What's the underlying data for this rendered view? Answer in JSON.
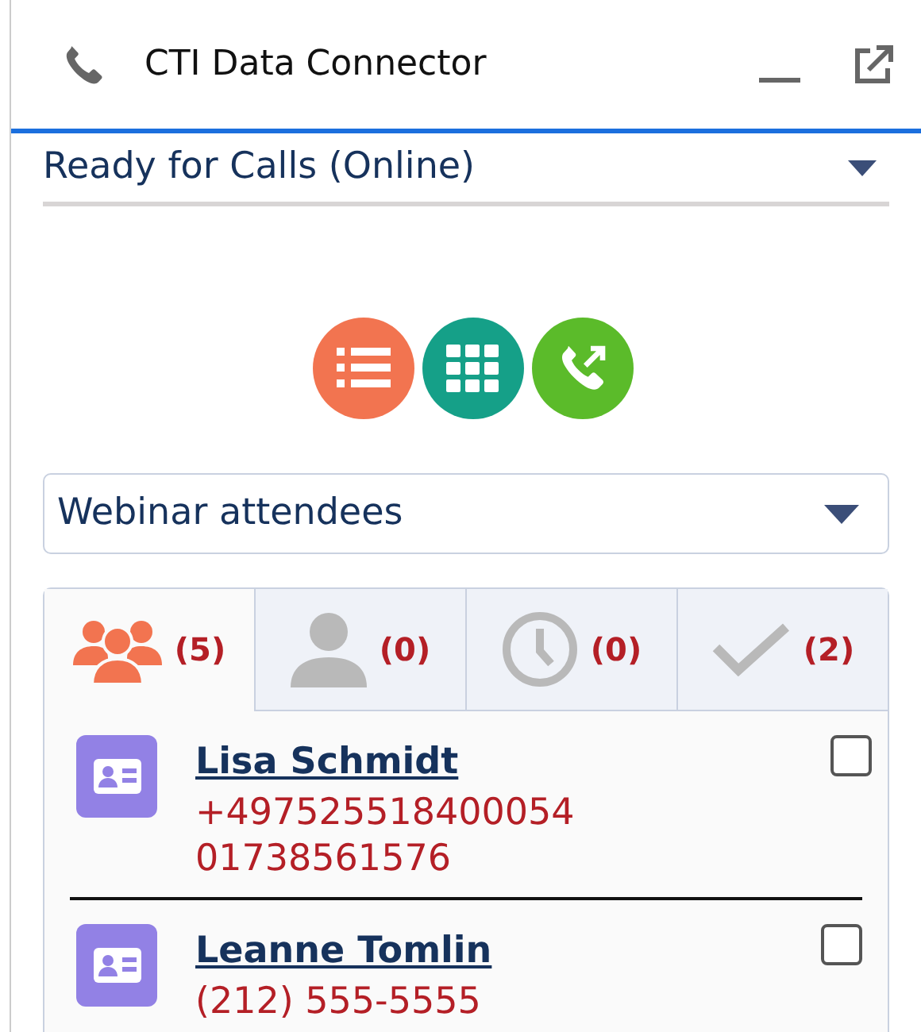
{
  "window": {
    "title": "CTI Data Connector"
  },
  "status": {
    "value": "Ready for Calls (Online)"
  },
  "actions": [
    {
      "kind": "list"
    },
    {
      "kind": "dialpad"
    },
    {
      "kind": "call"
    }
  ],
  "list_select": {
    "value": "Webinar attendees"
  },
  "tabs": [
    {
      "kind": "group",
      "count": "(5)",
      "selected": true
    },
    {
      "kind": "person",
      "count": "(0)",
      "selected": false
    },
    {
      "kind": "clock",
      "count": "(0)",
      "selected": false
    },
    {
      "kind": "check",
      "count": "(2)",
      "selected": false
    }
  ],
  "contacts": [
    {
      "name": "Lisa Schmidt",
      "phones": [
        "+497525518400054",
        "01738561576"
      ],
      "checked": false
    },
    {
      "name": "Leanne Tomlin",
      "phones": [
        "(212) 555-5555"
      ],
      "checked": false
    }
  ]
}
